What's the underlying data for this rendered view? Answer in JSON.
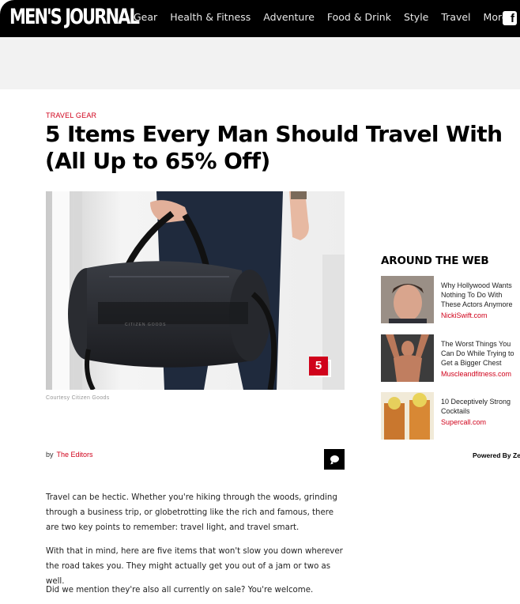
{
  "header": {
    "logo": "MEN'S JOURNAL",
    "nav": [
      "Gear",
      "Health & Fitness",
      "Adventure",
      "Food & Drink",
      "Style",
      "Travel",
      "More"
    ],
    "social": "f"
  },
  "article": {
    "kicker": "TRAVEL GEAR",
    "title_line1": "5 Items Every Man Should Travel With",
    "title_line2": "(All Up to 65% Off)",
    "gallery_count": "5",
    "caption": "Courtesy Citizen Goods",
    "byline_prefix": "by",
    "author": "The Editors",
    "paragraphs": [
      "Travel can be hectic. Whether you're hiking through the woods, grinding through a business trip, or globetrotting like the rich and famous, there are two key points to remember: travel light, and travel smart.",
      "With that in mind, here are five items that won't slow you down wherever the road takes you. They might actually get you out of a jam or two as well.",
      "Did we mention they're also all currently on sale? You're welcome."
    ]
  },
  "sidebar": {
    "title": "AROUND THE WEB",
    "items": [
      {
        "headline": "Why Hollywood Wants Nothing To Do With These Actors Anymore",
        "source": "NickiSwift.com"
      },
      {
        "headline": "The Worst Things You Can Do While Trying to Get a Bigger Chest",
        "source": "Muscleandfitness.com"
      },
      {
        "headline": "10 Deceptively Strong Cocktails",
        "source": "Supercall.com"
      }
    ],
    "powered_by": "Powered By Zergnet"
  }
}
